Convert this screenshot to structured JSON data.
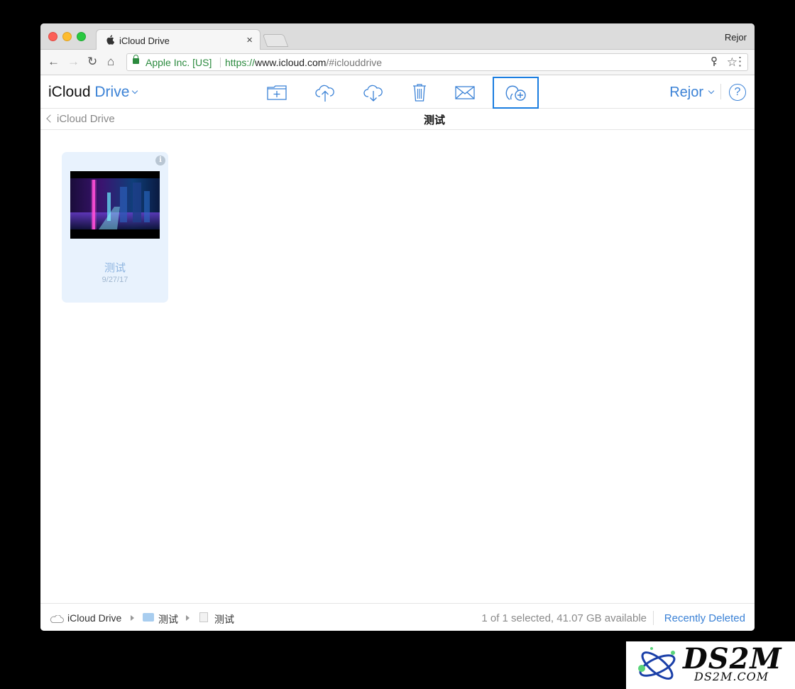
{
  "browser": {
    "tab_title": "iCloud Drive",
    "tab_close": "×",
    "profile": "Rejor",
    "secure_label": "Apple Inc. [US]",
    "url_scheme": "https://",
    "url_host": "www.icloud.com",
    "url_path": "/#iclouddrive",
    "back": "←",
    "forward": "→",
    "reload": "↻",
    "home": "⌂",
    "star": "☆",
    "menu": "⋮"
  },
  "app": {
    "brand_app": "iCloud",
    "brand_section": "Drive",
    "user": "Rejor",
    "help": "?",
    "toolbar_icons": [
      "new-folder-icon",
      "upload-icon",
      "download-icon",
      "trash-icon",
      "mail-icon",
      "share-person-add-icon"
    ],
    "accent_color": "#3b82d6"
  },
  "subbar": {
    "back_label": "iCloud Drive",
    "folder_title": "测试"
  },
  "files": [
    {
      "name": "测试",
      "date": "9/27/17",
      "info": "i"
    }
  ],
  "status": {
    "breadcrumbs": [
      "iCloud Drive",
      "测试",
      "测试"
    ],
    "summary": "1 of 1 selected, 41.07 GB available",
    "recently_deleted": "Recently Deleted"
  },
  "watermark": {
    "title": "DS2M",
    "subtitle": "DS2M.COM"
  }
}
